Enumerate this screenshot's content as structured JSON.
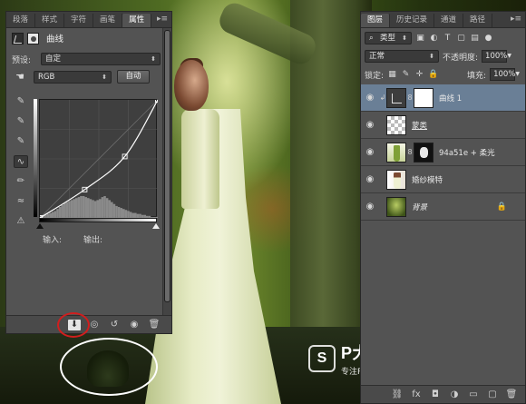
{
  "watermark": {
    "logo_letter": "S",
    "brand": "P大点S",
    "slogan": "专注Photoshop教程"
  },
  "properties_panel": {
    "tabs": [
      "段落",
      "样式",
      "字符",
      "画笔",
      "属性"
    ],
    "active_tab": "属性",
    "menu_icon": "panel-menu-icon",
    "title": "曲线",
    "preset_label": "预设:",
    "preset_value": "自定",
    "channel_value": "RGB",
    "auto_button": "自动",
    "input_label": "输入:",
    "output_label": "输出:",
    "tools": [
      "sample-shadows-icon",
      "sample-midtones-icon",
      "sample-highlights-icon",
      "curve-point-icon",
      "pencil-icon",
      "smooth-icon",
      "clipping-warning-icon"
    ],
    "footer_icons": [
      "clip-to-layer-icon",
      "view-previous-icon",
      "reset-icon",
      "visibility-icon",
      "trash-icon"
    ]
  },
  "layers_panel": {
    "tabs": [
      "图层",
      "历史记录",
      "通道",
      "路径"
    ],
    "active_tab": "图层",
    "filter_kind": "类型",
    "blend_mode": "正常",
    "opacity_label": "不透明度:",
    "opacity_value": "100%",
    "lock_label": "锁定:",
    "fill_label": "填充:",
    "fill_value": "100%",
    "layers": [
      {
        "name": "曲线 1",
        "selected": true
      },
      {
        "name": "蒙类",
        "selected": false
      },
      {
        "name": "94a51e + 柔光",
        "selected": false
      },
      {
        "name": "婚纱模特",
        "selected": false
      },
      {
        "name": "背景",
        "selected": false,
        "locked": true
      }
    ],
    "footer_icons": [
      "link-icon",
      "fx-icon",
      "add-mask-icon",
      "adjustment-icon",
      "group-icon",
      "new-layer-icon",
      "trash-icon"
    ]
  },
  "curves": {
    "points": [
      [
        0,
        0
      ],
      [
        0.38,
        0.24
      ],
      [
        0.72,
        0.52
      ],
      [
        1,
        1
      ]
    ],
    "histogram": [
      2,
      3,
      3,
      4,
      5,
      6,
      7,
      9,
      11,
      13,
      15,
      16,
      17,
      18,
      19,
      20,
      21,
      22,
      22,
      21,
      20,
      19,
      18,
      17,
      18,
      19,
      21,
      22,
      20,
      18,
      16,
      14,
      12,
      11,
      10,
      9,
      8,
      7,
      6,
      5,
      5,
      4,
      4,
      3,
      3,
      2,
      2,
      1,
      1,
      1
    ]
  }
}
